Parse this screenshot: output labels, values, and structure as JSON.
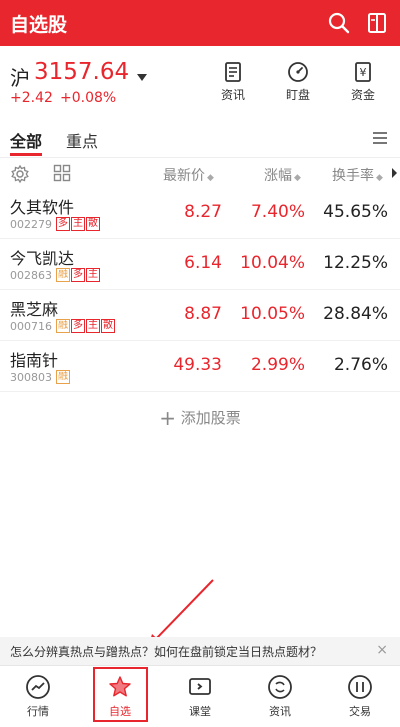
{
  "header": {
    "title": "自选股",
    "search_icon": "search-icon",
    "layout_icon": "layout-toggle-icon",
    "color": "#e8262d"
  },
  "index": {
    "name": "沪",
    "value": "3157.64",
    "change": "+2.42",
    "change_pct": "+0.08%"
  },
  "quick_actions": [
    {
      "label": "资讯",
      "icon": "news-document-icon"
    },
    {
      "label": "盯盘",
      "icon": "gauge-icon"
    },
    {
      "label": "资金",
      "icon": "yuan-document-icon"
    }
  ],
  "tabs": {
    "all": "全部",
    "focus": "重点"
  },
  "columns": {
    "price": "最新价",
    "change": "涨幅",
    "turnover": "换手率",
    "sort_glyph": "◆"
  },
  "stocks": [
    {
      "name": "久其软件",
      "code": "002279",
      "tags": [
        "多",
        "主",
        "散"
      ],
      "price": "8.27",
      "change": "7.40%",
      "turnover": "45.65%"
    },
    {
      "name": "今飞凯达",
      "code": "002863",
      "tags": [
        "融",
        "多",
        "主"
      ],
      "price": "6.14",
      "change": "10.04%",
      "turnover": "12.25%"
    },
    {
      "name": "黑芝麻",
      "code": "000716",
      "tags": [
        "融",
        "多",
        "主",
        "散"
      ],
      "price": "8.87",
      "change": "10.05%",
      "turnover": "28.84%"
    },
    {
      "name": "指南针",
      "code": "300803",
      "tags": [
        "融"
      ],
      "price": "49.33",
      "change": "2.99%",
      "turnover": "2.76%"
    }
  ],
  "add_stock": {
    "icon": "+",
    "label": "添加股票"
  },
  "banner": {
    "text": "怎么分辨真热点与蹭热点？如何在盘前锁定当日热点题材？",
    "close": "×"
  },
  "tabbar": [
    {
      "label": "行情",
      "icon": "market-trend-icon"
    },
    {
      "label": "自选",
      "icon": "star-icon"
    },
    {
      "label": "课堂",
      "icon": "video-play-icon"
    },
    {
      "label": "资讯",
      "icon": "refresh-news-icon"
    },
    {
      "label": "交易",
      "icon": "trade-icon"
    }
  ]
}
